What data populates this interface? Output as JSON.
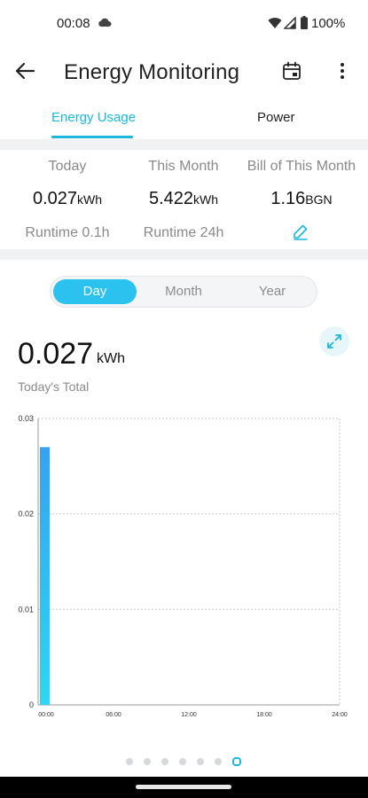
{
  "status_bar": {
    "time": "00:08",
    "battery": "100%"
  },
  "app_bar": {
    "title": "Energy Monitoring"
  },
  "tabs": [
    {
      "label": "Energy Usage",
      "active": true
    },
    {
      "label": "Power",
      "active": false
    }
  ],
  "summary": {
    "today": {
      "label": "Today",
      "value": "0.027",
      "unit": "kWh",
      "sub": "Runtime 0.1h"
    },
    "month": {
      "label": "This Month",
      "value": "5.422",
      "unit": "kWh",
      "sub": "Runtime 24h"
    },
    "bill": {
      "label": "Bill of This Month",
      "value": "1.16",
      "unit": "BGN"
    }
  },
  "segments": {
    "day": "Day",
    "month": "Month",
    "year": "Year",
    "selected": "Day"
  },
  "total": {
    "value": "0.027",
    "unit": "kWh",
    "label": "Today's Total"
  },
  "chart_data": {
    "type": "bar",
    "x_ticks": [
      "00:00",
      "06:00",
      "12:00",
      "18:00",
      "24:00"
    ],
    "y_ticks": [
      "0",
      "0.01",
      "0.02",
      "0.03"
    ],
    "ylim": [
      0,
      0.03
    ],
    "xlim": [
      0,
      24
    ],
    "grid": true,
    "bars": [
      {
        "hour": 0,
        "value": 0.027
      }
    ]
  },
  "pagination": {
    "count": 7,
    "active_index": 6
  },
  "colors": {
    "accent": "#1cb7dd",
    "bar_top": "#37a2f0",
    "bar_bottom": "#2fd6f2",
    "muted": "#8a8a8a"
  }
}
